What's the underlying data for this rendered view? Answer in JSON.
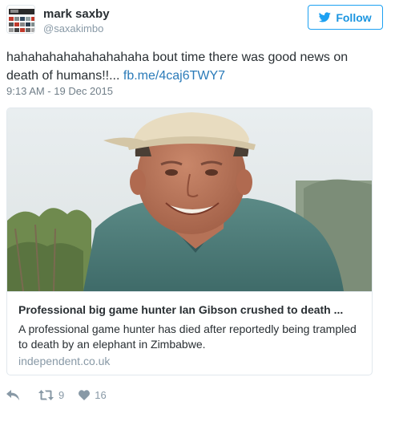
{
  "user": {
    "name": "mark saxby",
    "handle": "@saxakimbo",
    "avatar_icon": "profile-avatar"
  },
  "follow": {
    "label": "Follow",
    "icon": "twitter-bird-icon",
    "color": "#1da1f2"
  },
  "tweet": {
    "text": "hahahahahahahahahaha bout time there was good news on death of humans!!... ",
    "link_text": "fb.me/4caj6TWY7",
    "timestamp": "9:13 AM - 19 Dec 2015"
  },
  "card": {
    "image_alt": "photo of a man in a cap",
    "title": "Professional big game hunter Ian Gibson crushed to death ...",
    "description": "A professional game hunter has died after reportedly being trampled to death by an elephant in Zimbabwe.",
    "domain": "independent.co.uk"
  },
  "actions": {
    "reply_icon": "reply-icon",
    "retweet_icon": "retweet-icon",
    "retweet_count": "9",
    "like_icon": "heart-icon",
    "like_count": "16"
  },
  "colors": {
    "link": "#2b7bb9",
    "muted": "#8899a6",
    "text": "#292f33",
    "border": "#e1e8ed"
  }
}
